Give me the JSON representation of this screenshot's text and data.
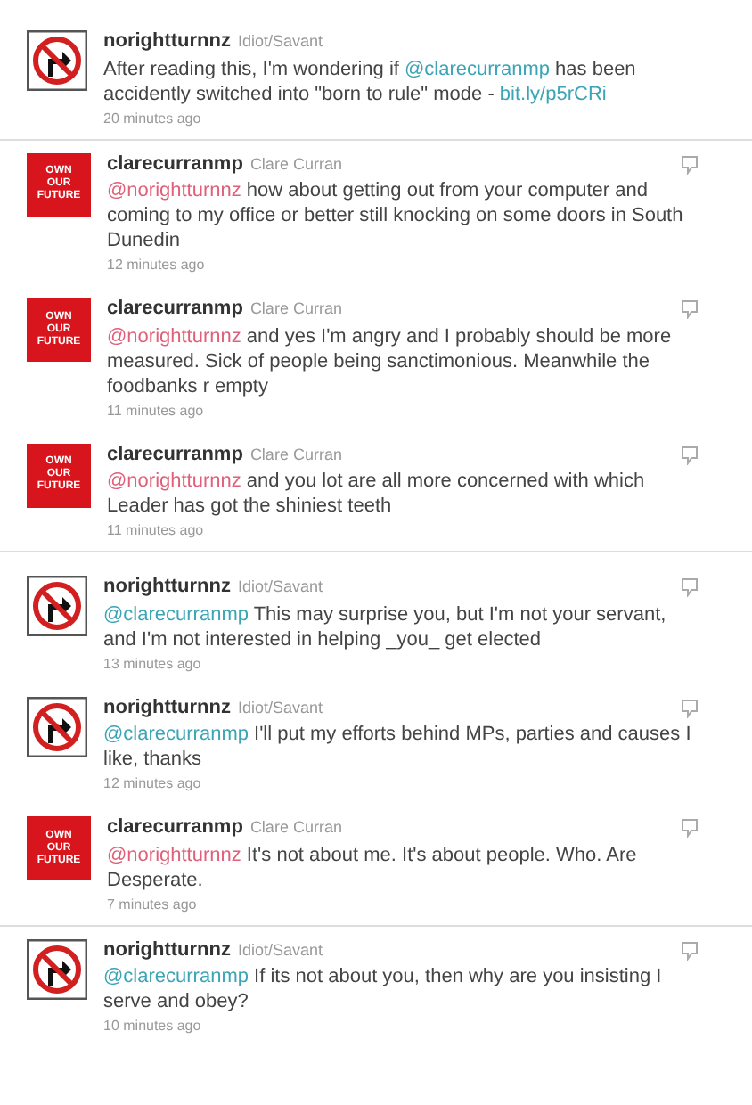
{
  "tweets": [
    {
      "avatar": {
        "kind": "sign"
      },
      "username": "norightturnnz",
      "full_name": "Idiot/Savant",
      "reply_icon": false,
      "body": [
        {
          "kind": "text",
          "text": "After reading this, I'm wondering if "
        },
        {
          "kind": "mention",
          "text": "@clarecurranmp",
          "color": "#3ba5b5"
        },
        {
          "kind": "text",
          "text": " has been accidently switched into \"born to rule\" mode - "
        },
        {
          "kind": "link",
          "text": "bit.ly/p5rCRi",
          "color": "#3ba5b5"
        }
      ],
      "time": "20 minutes ago"
    },
    {
      "avatar": {
        "kind": "logo",
        "lines": [
          "OWN",
          "OUR",
          "FUTURE"
        ]
      },
      "username": "clarecurranmp",
      "full_name": "Clare Curran",
      "reply_icon": true,
      "body": [
        {
          "kind": "mention",
          "text": "@norightturnnz",
          "color": "#e0607a"
        },
        {
          "kind": "text",
          "text": " how about getting out from your computer and coming to my office or better still knocking on some doors in South Dunedin"
        }
      ],
      "time": "12 minutes ago"
    },
    {
      "avatar": {
        "kind": "logo",
        "lines": [
          "OWN",
          "OUR",
          "FUTURE"
        ]
      },
      "username": "clarecurranmp",
      "full_name": "Clare Curran",
      "reply_icon": true,
      "body": [
        {
          "kind": "mention",
          "text": "@norightturnnz",
          "color": "#e0607a"
        },
        {
          "kind": "text",
          "text": " and yes I'm angry and I probably should be more measured. Sick of people being sanctimonious. Meanwhile the foodbanks r empty"
        }
      ],
      "time": "11 minutes ago"
    },
    {
      "avatar": {
        "kind": "logo",
        "lines": [
          "OWN",
          "OUR",
          "FUTURE"
        ]
      },
      "username": "clarecurranmp",
      "full_name": "Clare Curran",
      "reply_icon": true,
      "body": [
        {
          "kind": "mention",
          "text": "@norightturnnz",
          "color": "#e0607a"
        },
        {
          "kind": "text",
          "text": " and you lot are all more concerned with which Leader has got the shiniest teeth"
        }
      ],
      "time": "11 minutes ago"
    },
    {
      "avatar": {
        "kind": "sign"
      },
      "username": "norightturnnz",
      "full_name": "Idiot/Savant",
      "reply_icon": true,
      "body": [
        {
          "kind": "mention",
          "text": "@clarecurranmp",
          "color": "#3ba5b5"
        },
        {
          "kind": "text",
          "text": " This may surprise you, but I'm not your servant, and I'm not interested in helping _you_ get elected"
        }
      ],
      "time": "13 minutes ago"
    },
    {
      "avatar": {
        "kind": "sign"
      },
      "username": "norightturnnz",
      "full_name": "Idiot/Savant",
      "reply_icon": true,
      "body": [
        {
          "kind": "mention",
          "text": "@clarecurranmp",
          "color": "#3ba5b5"
        },
        {
          "kind": "text",
          "text": " I'll put my efforts behind MPs, parties and causes I like, thanks"
        }
      ],
      "time": "12 minutes ago"
    },
    {
      "avatar": {
        "kind": "logo",
        "lines": [
          "OWN",
          "OUR",
          "FUTURE"
        ]
      },
      "username": "clarecurranmp",
      "full_name": "Clare Curran",
      "reply_icon": true,
      "body": [
        {
          "kind": "mention",
          "text": "@norightturnnz",
          "color": "#e0607a"
        },
        {
          "kind": "text",
          "text": " It's not about me. It's about people. Who. Are Desperate."
        }
      ],
      "time": "7 minutes ago"
    },
    {
      "avatar": {
        "kind": "sign"
      },
      "username": "norightturnnz",
      "full_name": "Idiot/Savant",
      "reply_icon": true,
      "body": [
        {
          "kind": "mention",
          "text": "@clarecurranmp",
          "color": "#3ba5b5"
        },
        {
          "kind": "text",
          "text": " If its not about you, then why are you insisting I serve and obey?"
        }
      ],
      "time": "10 minutes ago"
    }
  ]
}
